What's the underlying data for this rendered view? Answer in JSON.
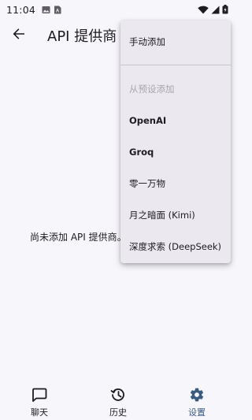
{
  "status_bar": {
    "time": "11:04",
    "left_icons": [
      "gallery-icon",
      "sim-icon"
    ],
    "right_icons": [
      "wifi-icon",
      "signal-icon",
      "battery-icon"
    ]
  },
  "app_bar": {
    "back_icon": "arrow-back-icon",
    "title": "API 提供商"
  },
  "empty_state": {
    "text": "尚未添加 API 提供商。"
  },
  "menu": {
    "manual_add": "手动添加",
    "preset_header": "从预设添加",
    "presets": [
      "OpenAI",
      "Groq",
      "零一万物",
      "月之暗面 (Kimi)",
      "深度求索 (DeepSeek)"
    ]
  },
  "bottom_nav": {
    "items": [
      {
        "label": "聊天",
        "icon": "chat-icon",
        "active": false
      },
      {
        "label": "历史",
        "icon": "history-icon",
        "active": false
      },
      {
        "label": "设置",
        "icon": "settings-icon",
        "active": true
      }
    ]
  },
  "colors": {
    "background": "#f7f6fb",
    "menu_background": "#ebe8f0",
    "active_accent": "#3a5a80",
    "subheader_text": "#a8a5ad"
  }
}
